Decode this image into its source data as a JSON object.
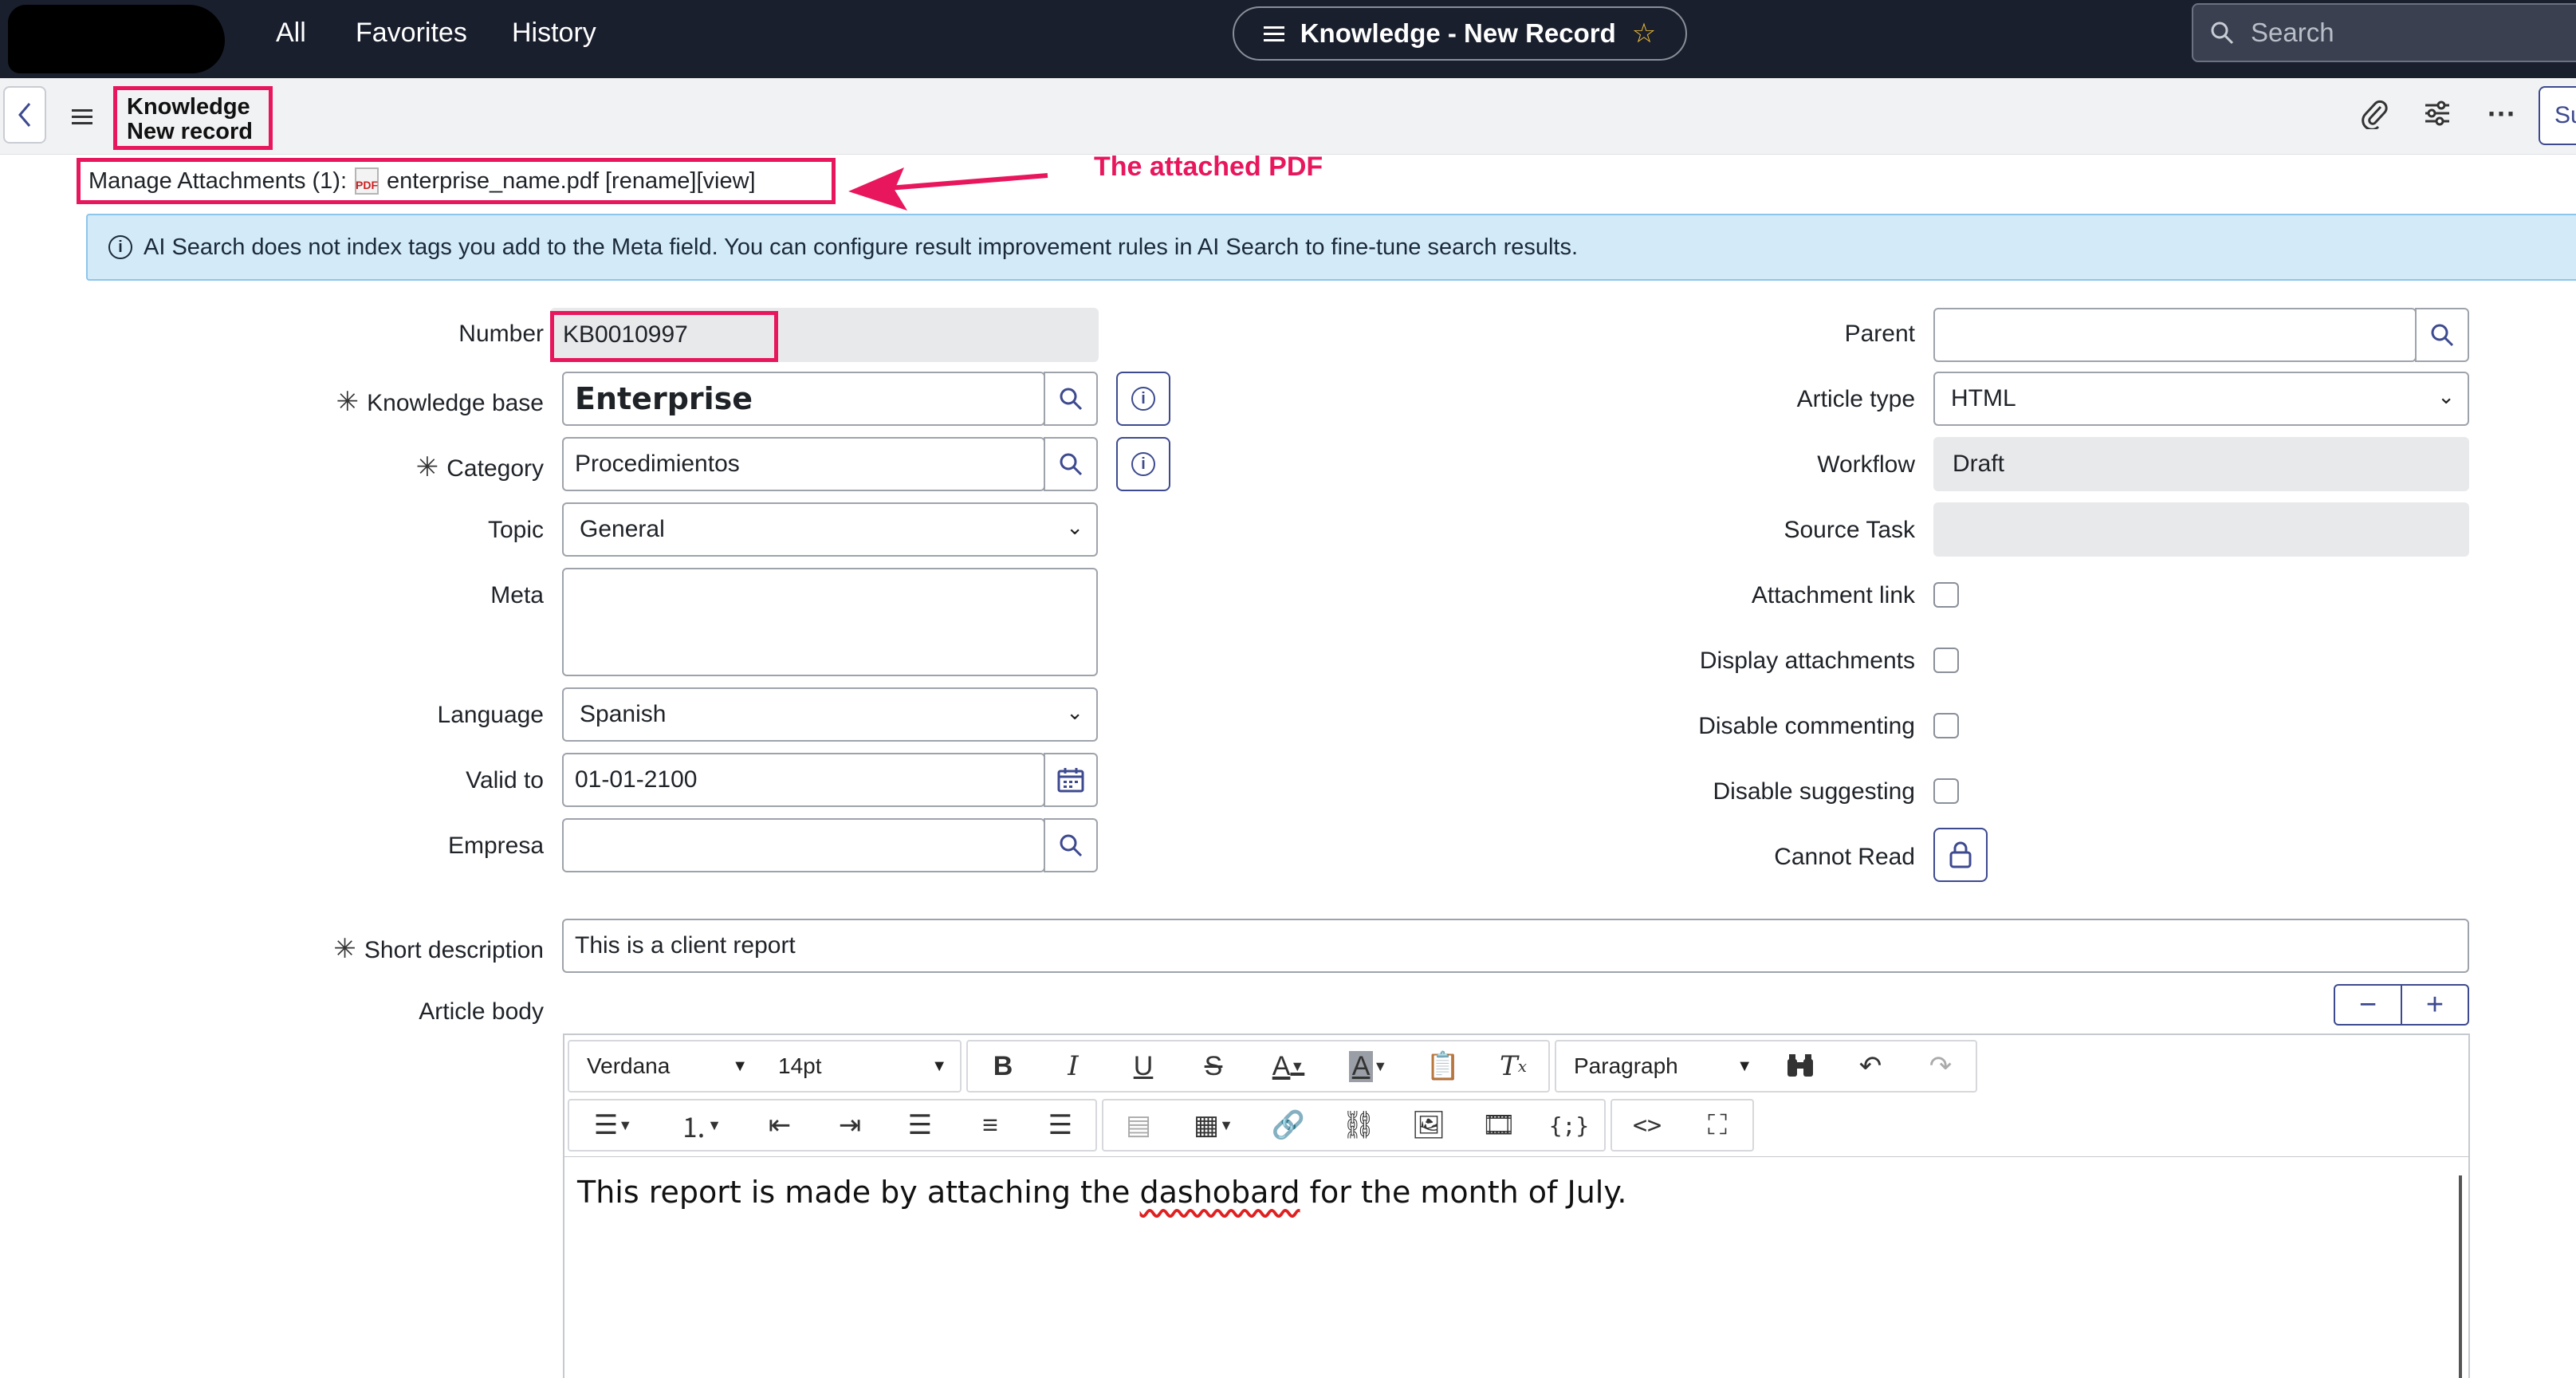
{
  "topnav": {
    "links": [
      "All",
      "Favorites",
      "History"
    ],
    "record_title": "Knowledge - New Record",
    "search_placeholder": "Search"
  },
  "subbar": {
    "title_line1": "Knowledge",
    "title_line2": "New record",
    "submit_stub": "Su"
  },
  "attachments": {
    "label": "Manage Attachments (1):",
    "file_name": "enterprise_name.pdf",
    "actions": "[rename][view]",
    "annotation": "The attached PDF"
  },
  "banner": {
    "text": "AI Search does not index tags you add to the Meta field. You can configure result improvement rules in AI Search to fine-tune search results."
  },
  "form": {
    "left": {
      "number_label": "Number",
      "number_value": "KB0010997",
      "kb_label": "Knowledge base",
      "kb_value": "Enterprise",
      "category_label": "Category",
      "category_value": "Procedimientos",
      "topic_label": "Topic",
      "topic_value": "General",
      "meta_label": "Meta",
      "meta_value": "",
      "language_label": "Language",
      "language_value": "Spanish",
      "valid_label": "Valid to",
      "valid_value": "01-01-2100",
      "empresa_label": "Empresa",
      "empresa_value": ""
    },
    "right": {
      "parent_label": "Parent",
      "parent_value": "",
      "article_type_label": "Article type",
      "article_type_value": "HTML",
      "workflow_label": "Workflow",
      "workflow_value": "Draft",
      "source_task_label": "Source Task",
      "source_task_value": "",
      "attachment_link_label": "Attachment link",
      "display_attachments_label": "Display attachments",
      "disable_commenting_label": "Disable commenting",
      "disable_suggesting_label": "Disable suggesting",
      "cannot_read_label": "Cannot Read"
    },
    "short_desc_label": "Short description",
    "short_desc_value": "This is a client report",
    "article_body_label": "Article body"
  },
  "editor": {
    "font_family": "Verdana",
    "font_size": "14pt",
    "block_format": "Paragraph",
    "content_before": "This report is made by attaching the ",
    "content_misspelled": "dashobard",
    "content_after": " for the month of July."
  },
  "colors": {
    "nav_bg": "#1a1f2e",
    "highlight": "#e8175d",
    "accent": "#3d4a8f",
    "banner_bg": "#d3eaf8"
  }
}
